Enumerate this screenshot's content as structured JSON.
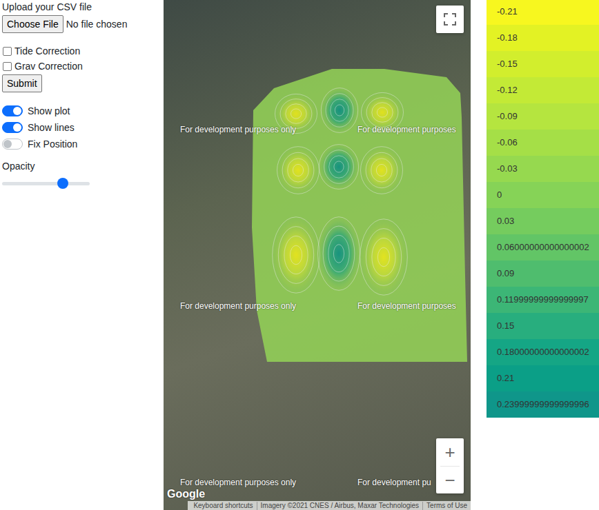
{
  "upload": {
    "label": "Upload your CSV file",
    "button": "Choose File",
    "file_status": "No file chosen"
  },
  "checkboxes": [
    {
      "label": "Tide Correction",
      "checked": false
    },
    {
      "label": "Grav Correction",
      "checked": false
    }
  ],
  "submit": "Submit",
  "toggles": [
    {
      "label": "Show plot",
      "on": true
    },
    {
      "label": "Show lines",
      "on": true
    },
    {
      "label": "Fix Position",
      "on": false
    }
  ],
  "opacity": {
    "label": "Opacity",
    "level": 0.72
  },
  "map": {
    "watermarks": [
      "For development purposes only",
      "For development purposes",
      "For development purposes only",
      "For development purposes",
      "For development purposes only",
      "For development pu"
    ],
    "zoom_in": "+",
    "zoom_out": "−",
    "logo": "Google",
    "attribution": [
      "Keyboard shortcuts",
      "Imagery ©2021 CNES / Airbus, Maxar Technologies",
      "Terms of Use"
    ]
  },
  "legend": [
    {
      "value": "-0.21",
      "color": "#f7f71f"
    },
    {
      "value": "-0.18",
      "color": "#e3f224"
    },
    {
      "value": "-0.15",
      "color": "#d2ee2d"
    },
    {
      "value": "-0.12",
      "color": "#c3ea36"
    },
    {
      "value": "-0.09",
      "color": "#b5e53f"
    },
    {
      "value": "-0.06",
      "color": "#a5df47"
    },
    {
      "value": "-0.03",
      "color": "#96d94f"
    },
    {
      "value": "0",
      "color": "#86d357"
    },
    {
      "value": "0.03",
      "color": "#75cc5e"
    },
    {
      "value": "0.06000000000000002",
      "color": "#62c566"
    },
    {
      "value": "0.09",
      "color": "#4fbd6e"
    },
    {
      "value": "0.11999999999999997",
      "color": "#3cb676"
    },
    {
      "value": "0.15",
      "color": "#28ae7e"
    },
    {
      "value": "0.18000000000000002",
      "color": "#15a685"
    },
    {
      "value": "0.21",
      "color": "#0b9f87"
    },
    {
      "value": "0.23999999999999996",
      "color": "#0f968a"
    }
  ]
}
